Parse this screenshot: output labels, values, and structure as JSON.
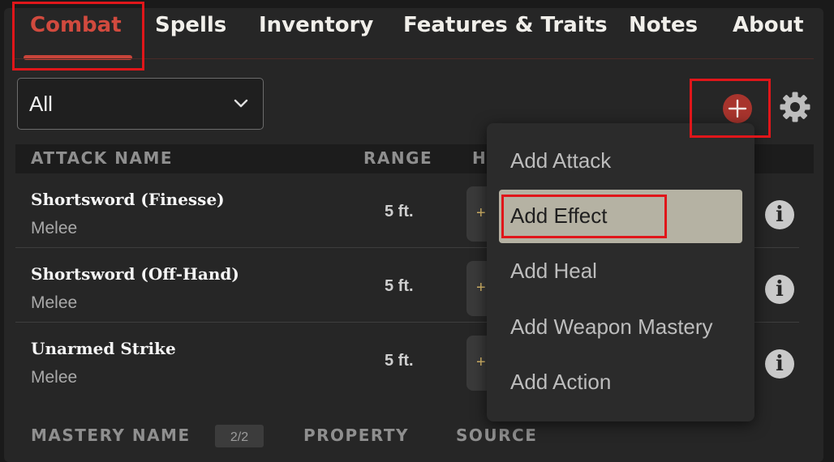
{
  "tabs": [
    {
      "label": "Combat",
      "active": true
    },
    {
      "label": "Spells"
    },
    {
      "label": "Inventory"
    },
    {
      "label": "Features & Traits"
    },
    {
      "label": "Notes"
    },
    {
      "label": "About"
    }
  ],
  "filter": {
    "value": "All"
  },
  "icons": {
    "add": "plus-circle-icon",
    "settings": "gear-icon",
    "dropdown": "chevron-down-icon",
    "info": "info-icon"
  },
  "attacks_table": {
    "headers": [
      "ATTACK NAME",
      "RANGE",
      "H"
    ],
    "rows": [
      {
        "name": "Shortsword (Finesse)",
        "type": "Melee",
        "range": "5 ft.",
        "hit": "+"
      },
      {
        "name": "Shortsword (Off-Hand)",
        "type": "Melee",
        "range": "5 ft.",
        "hit": "+"
      },
      {
        "name": "Unarmed Strike",
        "type": "Melee",
        "range": "5 ft.",
        "hit": "+"
      }
    ],
    "info_label": "i"
  },
  "mastery_table": {
    "headers": [
      "MASTERY NAME",
      "PROPERTY",
      "SOURCE"
    ],
    "count_badge": "2/2"
  },
  "add_menu": {
    "items": [
      {
        "label": "Add Attack"
      },
      {
        "label": "Add Effect",
        "selected": true
      },
      {
        "label": "Add Heal"
      },
      {
        "label": "Add Weapon Mastery"
      },
      {
        "label": "Add Action"
      }
    ]
  },
  "colors": {
    "accent": "#d14a3e",
    "add_button": "#a8342d",
    "menu_selected": "#b5b2a3",
    "highlight": "#e0161a"
  }
}
